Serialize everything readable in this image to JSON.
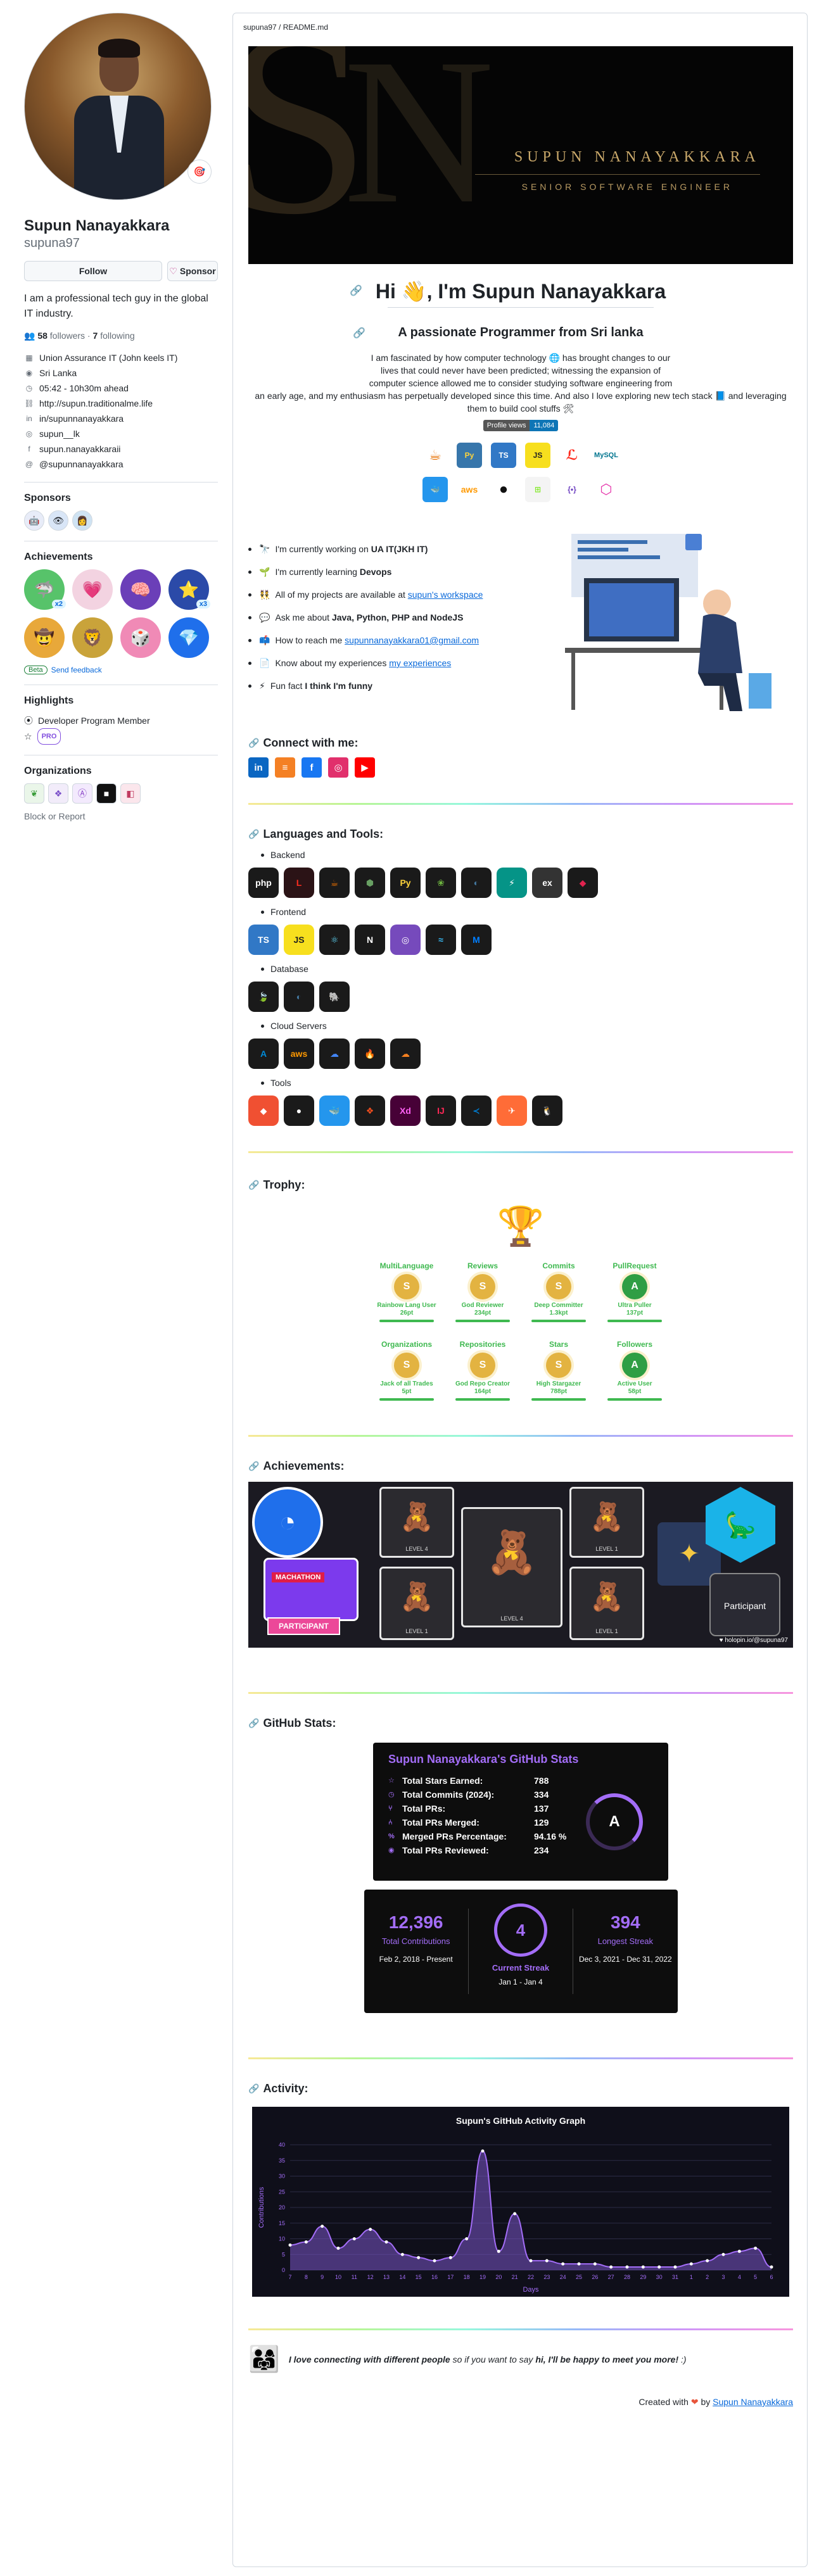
{
  "profile": {
    "name": "Supun Nanayakkara",
    "login": "supuna97",
    "status_emoji": "🎯",
    "follow_label": "Follow",
    "sponsor_label": "Sponsor",
    "bio": "I am a professional tech guy in the global IT industry.",
    "followers_count": "58",
    "followers_label": "followers",
    "following_count": "7",
    "following_label": "following",
    "details": [
      {
        "icon": "organization-icon",
        "glyph": "▦",
        "text": "Union Assurance IT (John keels IT)"
      },
      {
        "icon": "location-icon",
        "glyph": "◉",
        "text": "Sri Lanka"
      },
      {
        "icon": "clock-icon",
        "glyph": "◷",
        "text": "05:42 - 10h30m ahead"
      },
      {
        "icon": "link-icon",
        "glyph": "⛓",
        "text": "http://supun.traditionalme.life"
      },
      {
        "icon": "linkedin-icon",
        "glyph": "in",
        "text": "in/supunnanayakkara"
      },
      {
        "icon": "instagram-icon",
        "glyph": "◎",
        "text": "supun__lk"
      },
      {
        "icon": "facebook-icon",
        "glyph": "f",
        "text": "supun.nanayakkaraii"
      },
      {
        "icon": "mention-icon",
        "glyph": "@",
        "text": "@supunnanayakkara"
      }
    ],
    "sponsors_title": "Sponsors",
    "achievements_title": "Achievements",
    "achievements": [
      {
        "name": "pull-shark",
        "glyph": "🦈",
        "count": "x2",
        "color": "#57c36a"
      },
      {
        "name": "heart-on-sleeve",
        "glyph": "💗",
        "count": "",
        "color": "#f3d3e1"
      },
      {
        "name": "galaxy-brain",
        "glyph": "🧠",
        "count": "",
        "color": "#6b3fb8"
      },
      {
        "name": "starstruck",
        "glyph": "⭐",
        "count": "x3",
        "color": "#2b4aa8"
      },
      {
        "name": "quickdraw",
        "glyph": "🤠",
        "count": "",
        "color": "#e8a83a"
      },
      {
        "name": "arctic-code-vault",
        "glyph": "🦁",
        "count": "",
        "color": "#c9a33a"
      },
      {
        "name": "yolo",
        "glyph": "🎲",
        "count": "",
        "color": "#f08ab6"
      },
      {
        "name": "public-sponsor",
        "glyph": "💎",
        "count": "",
        "color": "#1f6feb"
      }
    ],
    "beta_label": "Beta",
    "feedback_label": "Send feedback",
    "highlights_title": "Highlights",
    "highlight_1": "Developer Program Member",
    "pro_label": "PRO",
    "organizations_title": "Organizations",
    "block_label": "Block or Report"
  },
  "readme": {
    "path": "supuna97 / README.md",
    "banner_name": "SUPUN NANAYAKKARA",
    "banner_role": "SENIOR SOFTWARE ENGINEER",
    "greeting": "Hi 👋, I'm Supun Nanayakkara",
    "tagline": "A passionate Programmer from Sri lanka",
    "intro_1": "I am fascinated by how computer technology 🌐 has brought changes to our",
    "intro_2": "lives that could never have been predicted; witnessing the expansion of",
    "intro_3": "computer science allowed me to consider studying software engineering from",
    "intro_4": "an early age, and my enthusiasm has perpetually developed since this time. And also I love exploring new tech stack 📘 and leveraging",
    "intro_5": "them to build cool stuffs 🛠",
    "views_label": "Profile views",
    "views_count": "11,084",
    "about": [
      {
        "emoji": "🔭",
        "pre": "I'm currently working on ",
        "bold": "UA IT(JKH IT)",
        "link": "",
        "post": ""
      },
      {
        "emoji": "🌱",
        "pre": "I'm currently learning ",
        "bold": "Devops",
        "link": "",
        "post": ""
      },
      {
        "emoji": "👯",
        "pre": "All of my projects are available at ",
        "bold": "",
        "link": "supun's workspace",
        "post": ""
      },
      {
        "emoji": "💬",
        "pre": "Ask me about ",
        "bold": "Java, Python, PHP and NodeJS",
        "link": "",
        "post": ""
      },
      {
        "emoji": "📫",
        "pre": "How to reach me ",
        "bold": "",
        "link": "supunnanayakkara01@gmail.com",
        "post": ""
      },
      {
        "emoji": "📄",
        "pre": "Know about my experiences ",
        "bold": "",
        "link": "my experiences",
        "post": ""
      },
      {
        "emoji": "⚡",
        "pre": "Fun fact ",
        "bold": "I think I'm funny",
        "link": "",
        "post": ""
      }
    ],
    "connect_title": "Connect with me:",
    "languages_title": "Languages and Tools:",
    "cat_backend": "Backend",
    "cat_frontend": "Frontend",
    "cat_database": "Database",
    "cat_cloud": "Cloud Servers",
    "cat_tools": "Tools",
    "trophy_title": "Trophy:",
    "trophies": [
      {
        "title": "MultiLanguage",
        "rank": "S",
        "sub1": "Rainbow Lang User",
        "sub2": "26pt",
        "color": "#e3b341"
      },
      {
        "title": "Reviews",
        "rank": "S",
        "sub1": "God Reviewer",
        "sub2": "234pt",
        "color": "#e3b341"
      },
      {
        "title": "Commits",
        "rank": "S",
        "sub1": "Deep Committer",
        "sub2": "1.3kpt",
        "color": "#e3b341"
      },
      {
        "title": "PullRequest",
        "rank": "A",
        "sub1": "Ultra Puller",
        "sub2": "137pt",
        "color": "#2f9e44"
      },
      {
        "title": "Organizations",
        "rank": "S",
        "sub1": "Jack of all Trades",
        "sub2": "5pt",
        "color": "#e3b341"
      },
      {
        "title": "Repositories",
        "rank": "S",
        "sub1": "God Repo Creator",
        "sub2": "164pt",
        "color": "#e3b341"
      },
      {
        "title": "Stars",
        "rank": "S",
        "sub1": "High Stargazer",
        "sub2": "788pt",
        "color": "#e3b341"
      },
      {
        "title": "Followers",
        "rank": "A",
        "sub1": "Active User",
        "sub2": "58pt",
        "color": "#2f9e44"
      }
    ],
    "achievements_title": "Achievements:",
    "ach_hack_1": "MACHATHON",
    "ach_hack_2": "PARTICIPANT",
    "ach_level_4": "LEVEL 4",
    "ach_level_1": "LEVEL 1",
    "ach_participant": "Participant",
    "ach_footer": "holopin.io/@supuna97",
    "github_stats_title": "GitHub Stats:",
    "stats_title": "Supun Nanayakkara's GitHub Stats",
    "stats": [
      {
        "icon": "star-icon",
        "glyph": "☆",
        "label": "Total Stars Earned:",
        "value": "788"
      },
      {
        "icon": "history-icon",
        "glyph": "◷",
        "label": "Total Commits (2024):",
        "value": "334"
      },
      {
        "icon": "pr-icon",
        "glyph": "⑂",
        "label": "Total PRs:",
        "value": "137"
      },
      {
        "icon": "merged-icon",
        "glyph": "⑃",
        "label": "Total PRs Merged:",
        "value": "129"
      },
      {
        "icon": "percent-icon",
        "glyph": "%",
        "label": "Merged PRs Percentage:",
        "value": "94.16 %"
      },
      {
        "icon": "review-icon",
        "glyph": "◉",
        "label": "Total PRs Reviewed:",
        "value": "234"
      }
    ],
    "grade": "A",
    "total_contrib": "12,396",
    "total_contrib_label": "Total Contributions",
    "total_contrib_range": "Feb 2, 2018 - Present",
    "current_streak": "4",
    "current_streak_label": "Current Streak",
    "current_streak_range": "Jan 1 - Jan 4",
    "longest_streak": "394",
    "longest_streak_label": "Longest Streak",
    "longest_streak_range": "Dec 3, 2021 - Dec 31, 2022",
    "activity_title": "Activity:",
    "footer_bold": "I love connecting with different people",
    "footer_mid": " so if you want to say ",
    "footer_hi": "hi, I'll be happy to meet you more!",
    "footer_end": " :)",
    "created_pre": "Created with",
    "created_by": "by",
    "created_link": "Supun Nanayakkara"
  },
  "chart_data": {
    "type": "area",
    "title": "Supun's GitHub Activity Graph",
    "xlabel": "Days",
    "ylabel": "Contributions",
    "ylim": [
      0,
      40
    ],
    "yticks": [
      0,
      5,
      10,
      15,
      20,
      25,
      30,
      35,
      40
    ],
    "x": [
      "7",
      "8",
      "9",
      "10",
      "11",
      "12",
      "13",
      "14",
      "15",
      "16",
      "17",
      "18",
      "19",
      "20",
      "21",
      "22",
      "23",
      "24",
      "25",
      "26",
      "27",
      "28",
      "29",
      "30",
      "31",
      "1",
      "2",
      "3",
      "4",
      "5",
      "6"
    ],
    "values": [
      8,
      9,
      14,
      7,
      10,
      13,
      9,
      5,
      4,
      3,
      4,
      10,
      38,
      6,
      18,
      3,
      3,
      2,
      2,
      2,
      1,
      1,
      1,
      1,
      1,
      2,
      3,
      5,
      6,
      7,
      1
    ],
    "colors": {
      "line": "#a36df7",
      "fill": "#7a56c6",
      "bg": "#0f0f1a",
      "grid": "#2b2b45"
    }
  }
}
